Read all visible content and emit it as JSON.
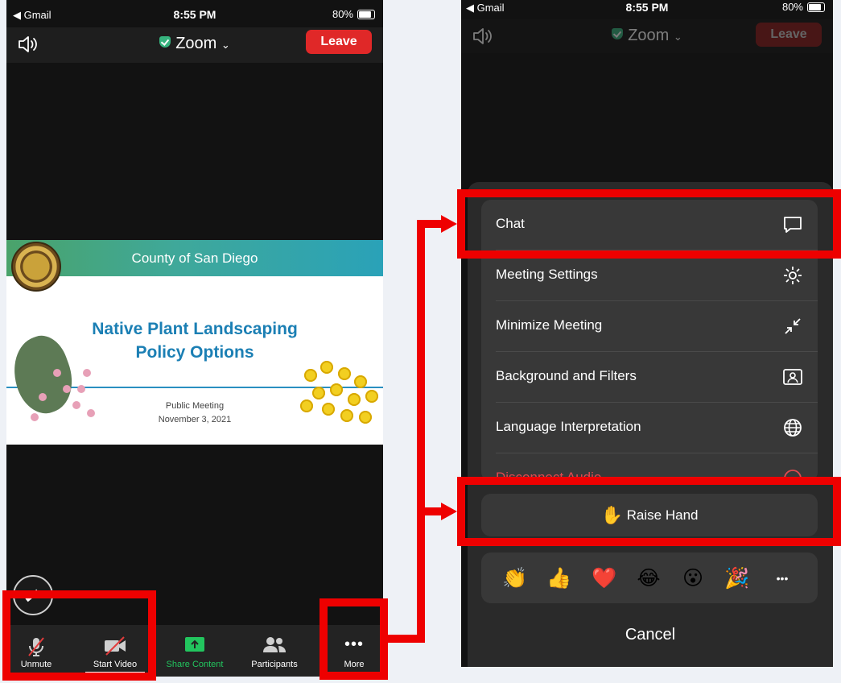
{
  "status_bar": {
    "carrier": "◀ Gmail",
    "time": "8:55 PM",
    "battery": "80%"
  },
  "meeting": {
    "title": "Zoom",
    "leave_label": "Leave"
  },
  "slide": {
    "header": "County of San Diego",
    "title_line1": "Native Plant Landscaping",
    "title_line2": "Policy Options",
    "subtitle_line1": "Public Meeting",
    "subtitle_line2": "November 3, 2021"
  },
  "toolbar": {
    "unmute": "Unmute",
    "start_video": "Start Video",
    "share_content": "Share Content",
    "participants": "Participants",
    "more": "More"
  },
  "more_menu": {
    "items": [
      {
        "label": "Chat",
        "icon": "chat-bubble-icon"
      },
      {
        "label": "Meeting Settings",
        "icon": "gear-icon"
      },
      {
        "label": "Minimize Meeting",
        "icon": "minimize-arrows-icon"
      },
      {
        "label": "Background and Filters",
        "icon": "portrait-frame-icon"
      },
      {
        "label": "Language Interpretation",
        "icon": "globe-icon"
      },
      {
        "label": "Disconnect Audio",
        "icon": "circle-icon"
      }
    ],
    "raise_hand": "Raise Hand",
    "raise_hand_emoji": "✋",
    "reactions": [
      "👏",
      "👍",
      "❤️",
      "😂",
      "😮",
      "🎉",
      "•••"
    ],
    "cancel": "Cancel"
  },
  "colors": {
    "leave_red": "#e02828",
    "share_green": "#22c55e",
    "annotation_red": "#ee0000",
    "secure_green": "#36b37e"
  }
}
